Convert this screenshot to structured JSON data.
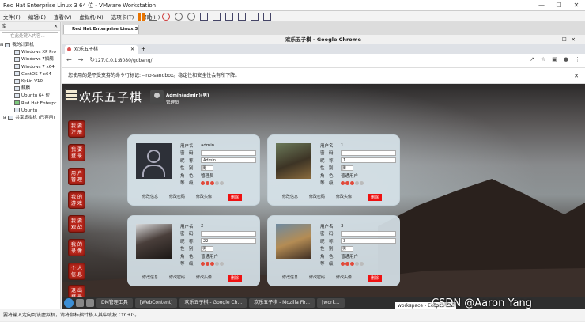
{
  "window": {
    "title": "Red Hat Enterprise Linux 3 64 位 - VMware Workstation"
  },
  "menu": [
    "文件(F)",
    "编辑(E)",
    "查看(V)",
    "虚拟机(M)",
    "选项卡(T)",
    "帮助(H)"
  ],
  "library": {
    "header": "库",
    "search_placeholder": "在此处键入内容...",
    "root": "我的计算机",
    "vms": [
      "Windows XP Pro",
      "Windows 7旗舰",
      "Windows 7 x64",
      "CentOS 7 x64",
      "KyLin V10",
      "麒麟",
      "Ubuntu 64 位",
      "Red Hat Enterpr",
      "Ubuntu"
    ],
    "shared": "共享虚拟机 (已弃用)"
  },
  "vm_tab": {
    "label": "Red Hat Enterprise Linux 3 ..."
  },
  "chrome": {
    "window_title": "欢乐五子棋 - Google Chrome",
    "tab_title": "欢乐五子棋",
    "url": "127.0.0.1:8080/gobang/",
    "info_message": "您使用的是不受支持的命令行标记: --no-sandbox。稳定性和安全性会有所下降。"
  },
  "app": {
    "title": "欢乐五子棋",
    "user_name": "Admin(admin)(男)",
    "user_role": "管理员",
    "side_buttons": [
      {
        "line1": "我 要",
        "line2": "注 册"
      },
      {
        "line1": "我 要",
        "line2": "登 录"
      },
      {
        "line1": "用 户",
        "line2": "管 理"
      },
      {
        "line1": "我 的",
        "line2": "游 戏"
      },
      {
        "line1": "我 要",
        "line2": "观 战"
      },
      {
        "line1": "我 的",
        "line2": "录 像"
      },
      {
        "line1": "个 人",
        "line2": "信 息"
      },
      {
        "line1": "退 出",
        "line2": "登 录"
      }
    ]
  },
  "labels": {
    "username": "用户名",
    "password": "密　码",
    "nickname": "昵　称",
    "gender": "性　别",
    "role": "角　色",
    "level": "等　级",
    "edit_info": "修改信息",
    "edit_pwd": "修改密码",
    "edit_avatar": "修改头像",
    "delete": "删除"
  },
  "users": [
    {
      "username": "admin",
      "nickname": "Admin",
      "gender": "男",
      "role": "管理员",
      "level": 3
    },
    {
      "username": "1",
      "nickname": "1",
      "gender": "男",
      "role": "普通用户",
      "level": 3
    },
    {
      "username": "2",
      "nickname": "22",
      "gender": "男",
      "role": "普通用户",
      "level": 3
    },
    {
      "username": "3",
      "nickname": "3",
      "gender": "男",
      "role": "普通用户",
      "level": 3
    }
  ],
  "taskbar": {
    "apps": [
      "DM管理工具",
      "[WebContent]",
      "欢乐五子棋 - Google Ch...",
      "欢乐五子棋 - Mozilla Fir...",
      "[work..."
    ],
    "tooltip": "workspace - Eclipse IDE"
  },
  "status_bar": "要将输入定向到该虚拟机，请将鼠标指针移入其中或按 Ctrl+G。",
  "watermark": "CSDN @Aaron Yang"
}
